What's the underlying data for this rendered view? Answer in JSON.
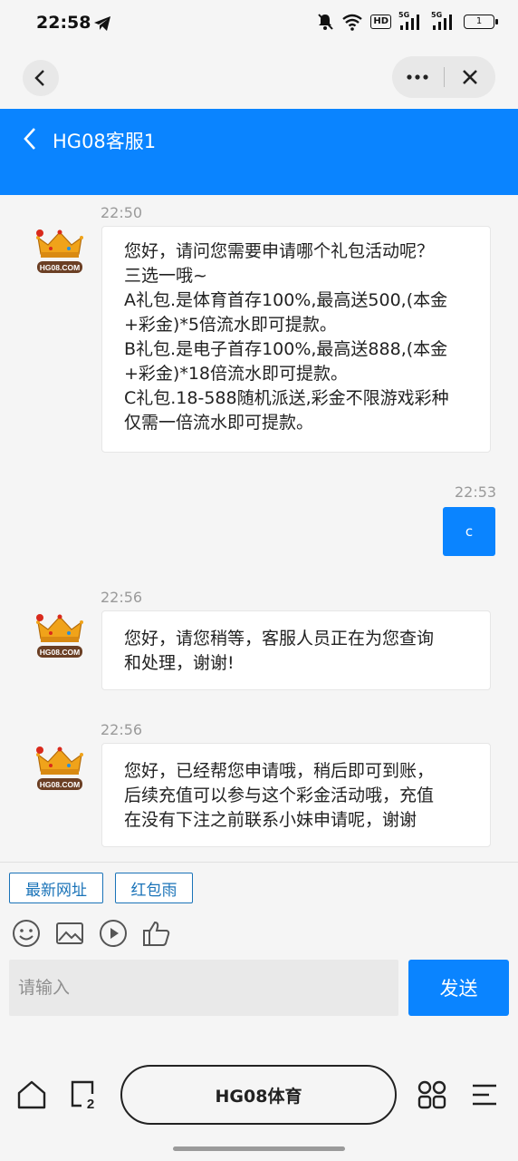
{
  "status_bar": {
    "time": "22:58",
    "signal_1": "5G",
    "signal_2": "5G",
    "hd": "HD",
    "battery": "1",
    "icons": [
      "telegram-icon",
      "mute-icon",
      "wifi-icon",
      "hd-icon",
      "signal-icon",
      "battery-icon"
    ]
  },
  "header": {
    "title": "HG08客服1"
  },
  "messages": [
    {
      "side": "left",
      "time": "22:50",
      "avatar_text": "HG08.COM",
      "lines": [
        "您好，请问您需要申请哪个礼包活动呢？",
        "三选一哦~",
        "A礼包.是体育首存100%,最高送500,(本金",
        "+彩金)*5倍流水即可提款。",
        "B礼包.是电子首存100%,最高送888,(本金",
        "+彩金)*18倍流水即可提款。",
        "C礼包.18-588随机派送,彩金不限游戏彩种",
        "仅需一倍流水即可提款。"
      ]
    },
    {
      "side": "right",
      "time": "22:53",
      "text": "c"
    },
    {
      "side": "left",
      "time": "22:56",
      "avatar_text": "HG08.COM",
      "lines": [
        "您好，请您稍等，客服人员正在为您查询",
        "和处理，谢谢!"
      ]
    },
    {
      "side": "left",
      "time": "22:56",
      "avatar_text": "HG08.COM",
      "lines": [
        "您好，已经帮您申请哦，稍后即可到账，",
        "后续充值可以参与这个彩金活动哦，充值",
        "在没有下注之前联系小妹申请呢，谢谢"
      ]
    }
  ],
  "quick_replies": [
    "最新网址",
    "红包雨"
  ],
  "toolbar_icons": [
    "emoji-icon",
    "image-icon",
    "video-icon",
    "thumbs-up-icon"
  ],
  "input": {
    "placeholder": "请输入",
    "value": ""
  },
  "send_label": "发送",
  "bottom_bar": {
    "title": "HG08体育",
    "tabs_count": "2"
  },
  "colors": {
    "accent": "#0a84ff",
    "chip_border": "#1a73b8",
    "background": "#f5f5f5"
  }
}
